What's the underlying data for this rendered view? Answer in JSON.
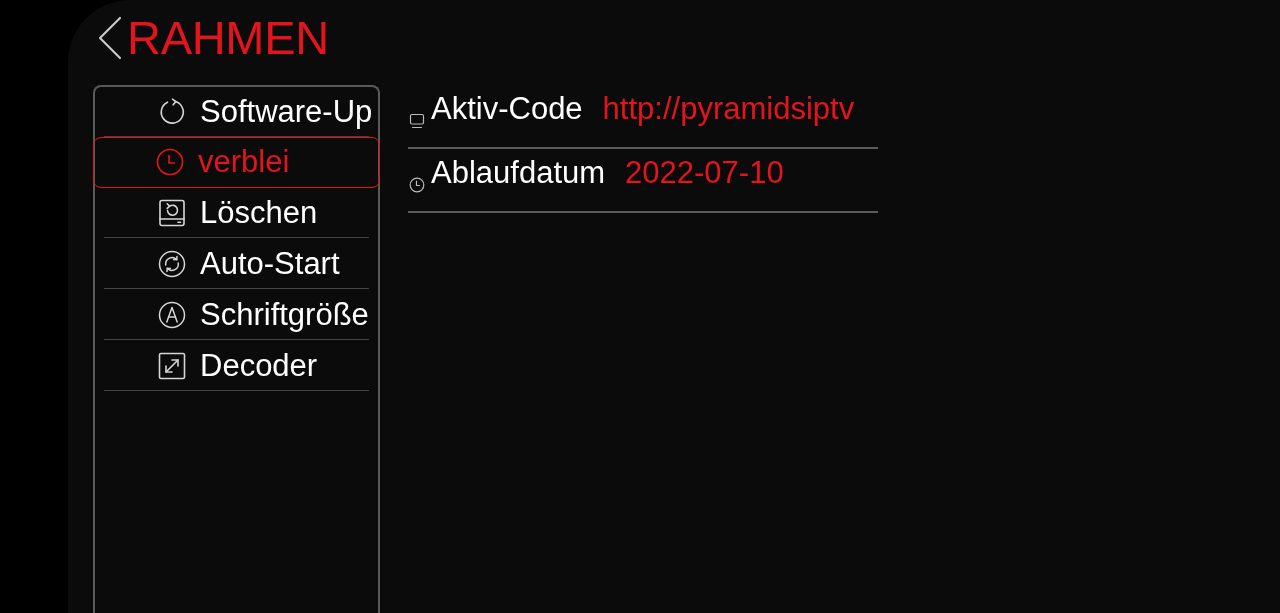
{
  "header": {
    "title": "RAHMEN"
  },
  "sidebar": {
    "items": [
      {
        "label": "Software-Up",
        "selected": false
      },
      {
        "label": "verblei",
        "selected": true
      },
      {
        "label": "Löschen",
        "selected": false
      },
      {
        "label": "Auto-Start",
        "selected": false
      },
      {
        "label": "Schriftgröße",
        "selected": false
      },
      {
        "label": "Decoder",
        "selected": false
      }
    ]
  },
  "info": {
    "rows": [
      {
        "label": "Aktiv-Code",
        "value": "http://pyramidsiptv"
      },
      {
        "label": "Ablaufdatum",
        "value": "2022-07-10"
      }
    ]
  }
}
